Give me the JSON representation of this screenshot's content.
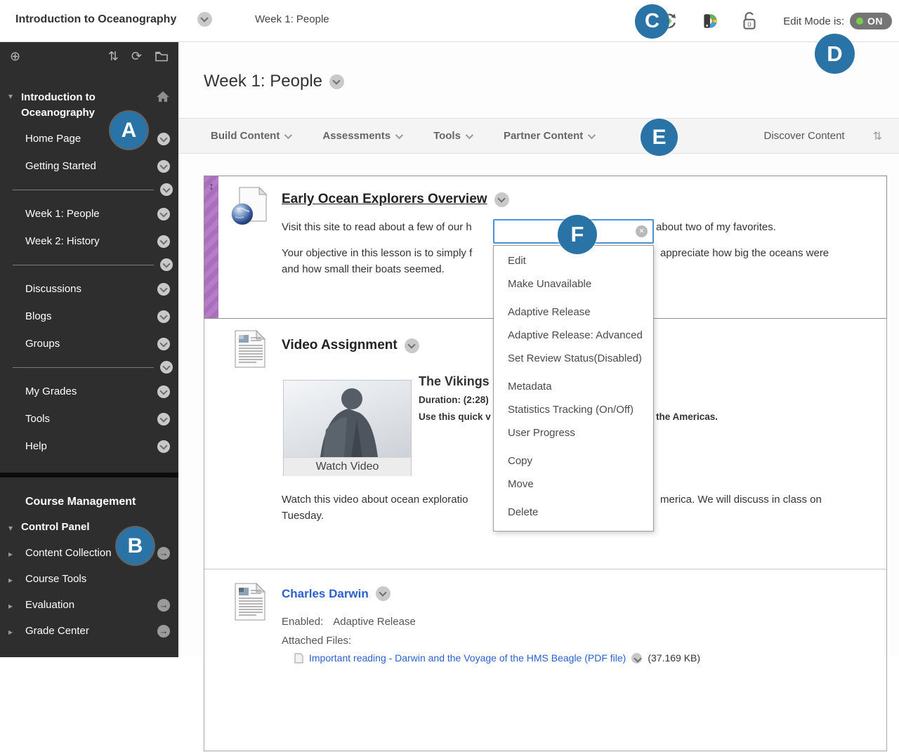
{
  "topbar": {
    "course_title": "Introduction to Oceanography",
    "breadcrumb": "Week 1: People",
    "edit_mode_label": "Edit Mode is:",
    "edit_mode_value": "ON"
  },
  "badges": {
    "a": "A",
    "b": "B",
    "c": "C",
    "d": "D",
    "e": "E",
    "f": "F"
  },
  "icons": {
    "add": "⊕",
    "reorder": "⇅",
    "refresh": "⟳",
    "arrow_right": "→",
    "tri_down": "▾",
    "tri_right": "▸",
    "move_handle": "↕",
    "clear": "×",
    "sort": "⇅"
  },
  "sidebar": {
    "course_name": "Introduction to Oceanography",
    "groups": [
      [
        "Home Page",
        "Getting Started"
      ],
      [
        "Week 1: People",
        "Week 2: History"
      ],
      [
        "Discussions",
        "Blogs",
        "Groups"
      ],
      [
        "My Grades",
        "Tools",
        "Help"
      ]
    ],
    "management_heading": "Course Management",
    "control_panel": "Control Panel",
    "management_items": [
      "Content Collection",
      "Course Tools",
      "Evaluation",
      "Grade Center"
    ]
  },
  "main": {
    "page_title": "Week 1: People",
    "action_buttons": [
      "Build Content",
      "Assessments",
      "Tools",
      "Partner Content"
    ],
    "discover_label": "Discover Content",
    "menu": {
      "search_value": "",
      "items": [
        "Edit",
        "Make Unavailable",
        "Adaptive Release",
        "Adaptive Release: Advanced",
        "Set Review Status(Disabled)",
        "Metadata",
        "Statistics Tracking (On/Off)",
        "User Progress",
        "Copy",
        "Move",
        "Delete"
      ]
    },
    "explorers": {
      "title": "Early Ocean Explorers Overview",
      "p1_left": "Visit this site to read about a few of our h",
      "p1_right": "about two of my favorites.",
      "p2_left": "Your objective in this lesson is to simply f",
      "p2_right": "appreciate how big the oceans were",
      "p2_line2": "and how small their boats seemed."
    },
    "video": {
      "title": "Video Assignment",
      "video_title": "The Vikings",
      "duration": "Duration: (2:28)",
      "use_left": "Use this quick v",
      "use_right": "the Americas.",
      "watch_label": "Watch Video",
      "desc_left": "Watch this video about ocean exploratio",
      "desc_right": "merica. We will discuss in class on",
      "desc_line2": "Tuesday."
    },
    "darwin": {
      "title": "Charles Darwin",
      "enabled_label": "Enabled:",
      "enabled_value": "Adaptive Release",
      "attached_label": "Attached Files:",
      "file_text": "Important reading - Darwin and the Voyage of the HMS Beagle (PDF file)",
      "file_size": "(37.169 KB)"
    }
  }
}
